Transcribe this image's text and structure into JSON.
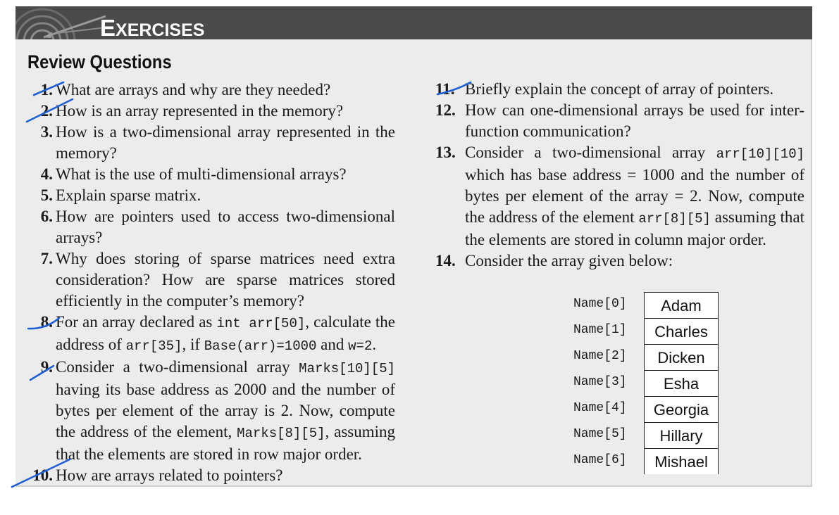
{
  "header": {
    "title_first": "E",
    "title_rest": "XERCISES"
  },
  "section": {
    "title": "Review Questions"
  },
  "questions_left": [
    {
      "num": "1.",
      "parts": [
        "What are arrays and why are they needed?"
      ]
    },
    {
      "num": "2.",
      "parts": [
        "How is an array represented in the memory?"
      ]
    },
    {
      "num": "3.",
      "parts": [
        "How is a two-dimensional array represented in the memory?"
      ]
    },
    {
      "num": "4.",
      "parts": [
        "What is the use of multi-dimensional arrays?"
      ]
    },
    {
      "num": "5.",
      "parts": [
        "Explain sparse matrix."
      ]
    },
    {
      "num": "6.",
      "parts": [
        "How are pointers used to access two-dimensional arrays?"
      ]
    },
    {
      "num": "7.",
      "parts": [
        "Why does storing of sparse matrices need extra consideration? How are sparse matrices stored efficiently in the computer’s memory?"
      ]
    },
    {
      "num": "8.",
      "parts": [
        "For an array declared as ",
        "int arr[50]",
        ", calculate the address of ",
        "arr[35]",
        ", if ",
        "Base(arr)=1000",
        " and ",
        "w=2",
        "."
      ]
    },
    {
      "num": "9.",
      "parts": [
        "Consider a two-dimensional array ",
        "Marks[10][5]",
        " having its base address as 2000 and the number of bytes per element of the array is 2. Now, compute the address of the element, ",
        "Marks[8][5]",
        ", assuming that the elements are stored in row major order."
      ]
    },
    {
      "num": "10.",
      "parts": [
        "How are arrays related to pointers?"
      ]
    }
  ],
  "questions_right": [
    {
      "num": "11.",
      "parts": [
        "Briefly explain the concept of array of pointers."
      ]
    },
    {
      "num": "12.",
      "parts": [
        "How can one-dimensional arrays be used for inter-function communication?"
      ]
    },
    {
      "num": "13.",
      "parts": [
        "Consider a two-dimensional array ",
        "arr[10][10]",
        " which has base address = 1000 and the number of bytes per element of the array = 2. Now, compute the address of the element ",
        "arr[8][5]",
        " assuming that the elements are stored in column major order."
      ]
    },
    {
      "num": "14.",
      "parts": [
        "Consider the array given below:"
      ]
    }
  ],
  "array_table": {
    "labels": [
      "Name[0]",
      "Name[1]",
      "Name[2]",
      "Name[3]",
      "Name[4]",
      "Name[5]",
      "Name[6]"
    ],
    "values": [
      "Adam",
      "Charles",
      "Dicken",
      "Esha",
      "Georgia",
      "Hillary",
      "Mishael"
    ]
  }
}
